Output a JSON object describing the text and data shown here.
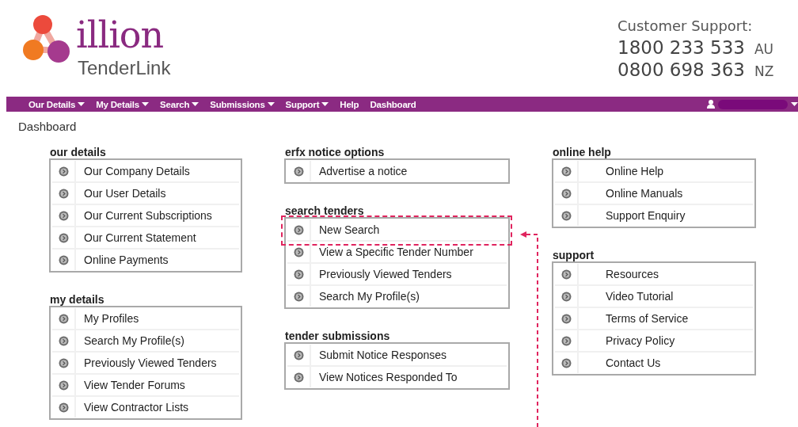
{
  "brand": {
    "name": "illion",
    "product": "TenderLink"
  },
  "support": {
    "label": "Customer Support:",
    "phones": [
      {
        "number": "1800 233 533",
        "region": "AU"
      },
      {
        "number": "0800 698 363",
        "region": "NZ"
      }
    ]
  },
  "nav": [
    {
      "label": "Our Details",
      "has_menu": true
    },
    {
      "label": "My Details",
      "has_menu": true
    },
    {
      "label": "Search",
      "has_menu": true
    },
    {
      "label": "Submissions",
      "has_menu": true
    },
    {
      "label": "Support",
      "has_menu": true
    },
    {
      "label": "Help",
      "has_menu": false
    },
    {
      "label": "Dashboard",
      "has_menu": false
    }
  ],
  "page_title": "Dashboard",
  "columns": [
    [
      {
        "title": "our details",
        "items": [
          {
            "label": "Our Company Details",
            "highlighted": false
          },
          {
            "label": "Our User Details",
            "highlighted": false
          },
          {
            "label": "Our Current Subscriptions",
            "highlighted": false
          },
          {
            "label": "Our Current Statement",
            "highlighted": false
          },
          {
            "label": "Online Payments",
            "highlighted": false
          }
        ]
      },
      {
        "title": "my details",
        "items": [
          {
            "label": "My Profiles",
            "highlighted": false
          },
          {
            "label": "Search My Profile(s)",
            "highlighted": false
          },
          {
            "label": "Previously Viewed Tenders",
            "highlighted": false
          },
          {
            "label": "View Tender Forums",
            "highlighted": false
          },
          {
            "label": "View Contractor Lists",
            "highlighted": false
          }
        ]
      }
    ],
    [
      {
        "title": "erfx notice options",
        "items": [
          {
            "label": "Advertise a notice",
            "highlighted": false
          }
        ]
      },
      {
        "title": "search tenders",
        "items": [
          {
            "label": "New Search",
            "highlighted": true
          },
          {
            "label": "View a Specific Tender Number",
            "highlighted": false
          },
          {
            "label": "Previously Viewed Tenders",
            "highlighted": false
          },
          {
            "label": "Search My Profile(s)",
            "highlighted": false
          }
        ]
      },
      {
        "title": "tender submissions",
        "items": [
          {
            "label": "Submit Notice Responses",
            "highlighted": false
          },
          {
            "label": "View Notices Responded To",
            "highlighted": false
          }
        ]
      }
    ],
    [
      {
        "title": "online help",
        "items": [
          {
            "label": "Online Help",
            "highlighted": false
          },
          {
            "label": "Online Manuals",
            "highlighted": false
          },
          {
            "label": "Support Enquiry",
            "highlighted": false
          }
        ]
      },
      {
        "title": "support",
        "items": [
          {
            "label": "Resources",
            "highlighted": false
          },
          {
            "label": "Video Tutorial",
            "highlighted": false
          },
          {
            "label": "Terms of Service",
            "highlighted": false
          },
          {
            "label": "Privacy Policy",
            "highlighted": false
          },
          {
            "label": "Contact Us",
            "highlighted": false
          }
        ]
      }
    ]
  ]
}
